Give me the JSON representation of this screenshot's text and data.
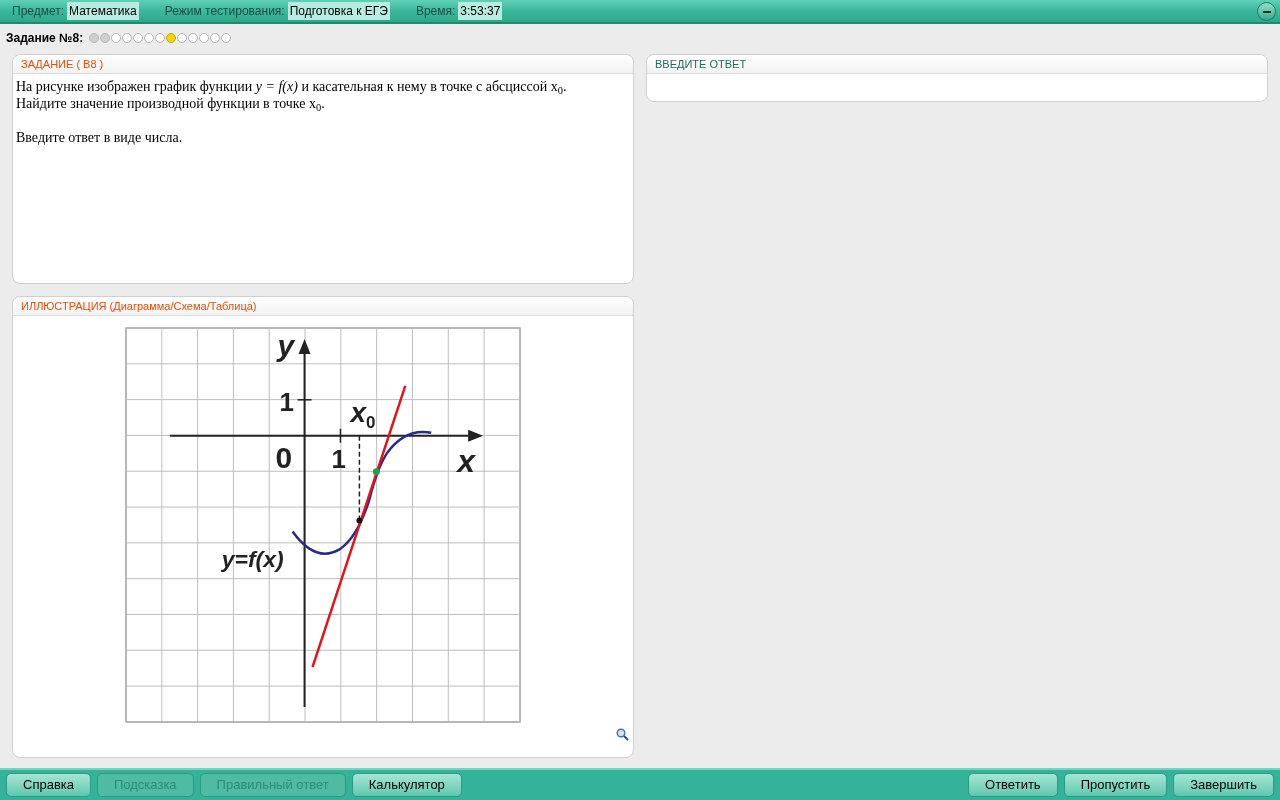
{
  "header": {
    "fields": [
      {
        "label": "Предмет:",
        "value": "Математика"
      },
      {
        "label": "Режим тестирования:",
        "value": "Подготовка к ЕГЭ"
      },
      {
        "label": "Время:",
        "value": "3:53:37"
      }
    ]
  },
  "progress": {
    "label": "Задание №8:",
    "dots": [
      {
        "kind": "visited"
      },
      {
        "kind": "visited"
      },
      {
        "kind": "unvisited"
      },
      {
        "kind": "unvisited"
      },
      {
        "kind": "unvisited"
      },
      {
        "kind": "unvisited"
      },
      {
        "kind": "unvisited"
      },
      {
        "kind": "current"
      },
      {
        "kind": "unvisited"
      },
      {
        "kind": "unvisited"
      },
      {
        "kind": "unvisited"
      },
      {
        "kind": "unvisited"
      },
      {
        "kind": "unvisited"
      }
    ]
  },
  "task": {
    "title": "ЗАДАНИЕ  ( В8 )",
    "paragraphs": [
      "На рисунке изображен график функции  *y = f(x)*  и касательная к нему в точке с абсциссой x$_{0}$.",
      "Найдите значение производной функции в точке x$_{0}$.",
      "Введите ответ в виде числа."
    ]
  },
  "illustration": {
    "title": "ИЛЛЮСТРАЦИЯ (Диаграмма/Схема/Таблица)",
    "labels": {
      "y_axis": "y",
      "x_axis": "x",
      "origin": "0",
      "y_tick": "1",
      "x_tick": "1",
      "x0": "x",
      "x0_index": "0",
      "function": "y=f(x)"
    }
  },
  "answer": {
    "title": "ВВЕДИТЕ ОТВЕТ"
  },
  "footer": {
    "left": [
      {
        "label": "Справка",
        "disabled": false
      },
      {
        "label": "Подсказка",
        "disabled": true
      },
      {
        "label": "Правильный ответ",
        "disabled": true
      },
      {
        "label": "Калькулятор",
        "disabled": false
      }
    ],
    "right": [
      {
        "label": "Ответить",
        "disabled": false
      },
      {
        "label": "Пропустить",
        "disabled": false
      },
      {
        "label": "Завершить",
        "disabled": false
      }
    ]
  }
}
